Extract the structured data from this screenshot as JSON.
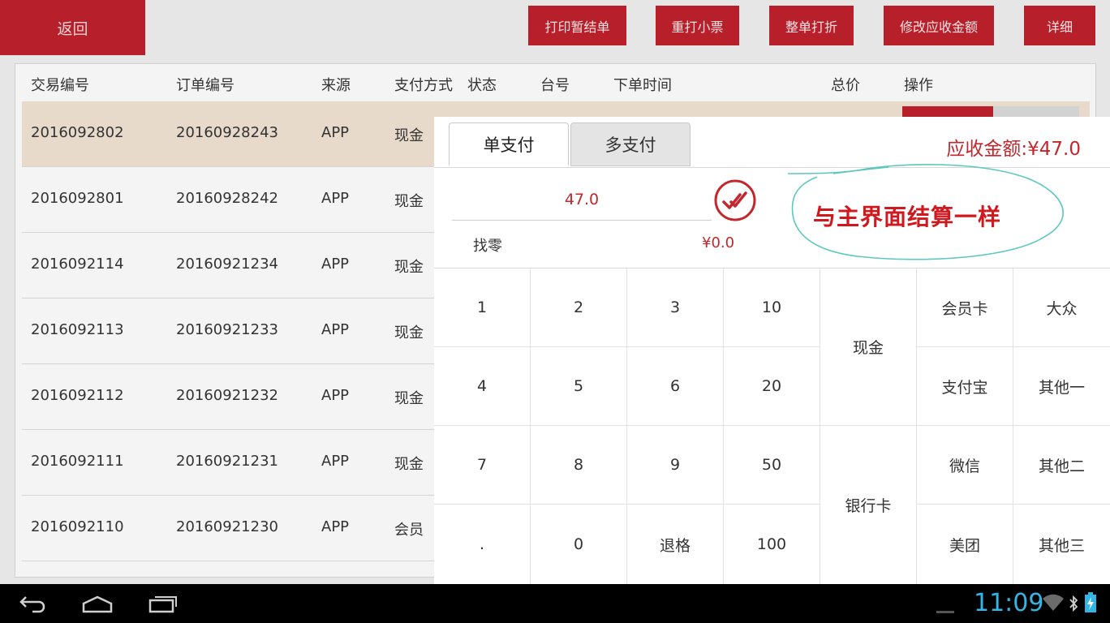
{
  "topbar": {
    "back_label": "返回",
    "buttons": [
      "打印暂结单",
      "重打小票",
      "整单打折",
      "修改应收金额",
      "详细"
    ]
  },
  "table": {
    "headers": [
      "交易编号",
      "订单编号",
      "来源",
      "支付方式",
      "状态",
      "台号",
      "下单时间",
      "总价",
      "操作"
    ],
    "rows": [
      {
        "trade_no": "2016092802",
        "order_no": "20160928243",
        "source": "APP",
        "pay": "现金"
      },
      {
        "trade_no": "2016092801",
        "order_no": "20160928242",
        "source": "APP",
        "pay": "现金"
      },
      {
        "trade_no": "2016092114",
        "order_no": "20160921234",
        "source": "APP",
        "pay": "现金"
      },
      {
        "trade_no": "2016092113",
        "order_no": "20160921233",
        "source": "APP",
        "pay": "现金"
      },
      {
        "trade_no": "2016092112",
        "order_no": "20160921232",
        "source": "APP",
        "pay": "现金"
      },
      {
        "trade_no": "2016092111",
        "order_no": "20160921231",
        "source": "APP",
        "pay": "现金"
      },
      {
        "trade_no": "2016092110",
        "order_no": "20160921230",
        "source": "APP",
        "pay": "会员"
      }
    ]
  },
  "modal": {
    "tab_single": "单支付",
    "tab_multi": "多支付",
    "due_amount": "应收金额:¥47.0",
    "amount_value": "47.0",
    "change_label": "找零",
    "change_value": "¥0.0",
    "annotation": "与主界面结算一样",
    "keys": {
      "k1": "1",
      "k2": "2",
      "k3": "3",
      "k10": "10",
      "k4": "4",
      "k5": "5",
      "k6": "6",
      "k20": "20",
      "k7": "7",
      "k8": "8",
      "k9": "9",
      "k50": "50",
      "kdot": ".",
      "k0": "0",
      "kback": "退格",
      "k100": "100",
      "cash": "现金",
      "bank": "银行卡",
      "member_card": "会员卡",
      "dazhong": "大众",
      "alipay": "支付宝",
      "other1": "其他一",
      "wechat": "微信",
      "other2": "其他二",
      "meituan": "美团",
      "other3": "其他三"
    }
  },
  "statusbar": {
    "time": "11:09"
  },
  "colors": {
    "accent_red": "#b7202a",
    "amount_red": "#c1272d",
    "annotation_teal": "#5cc7bd",
    "clock_blue": "#33b5e5"
  }
}
